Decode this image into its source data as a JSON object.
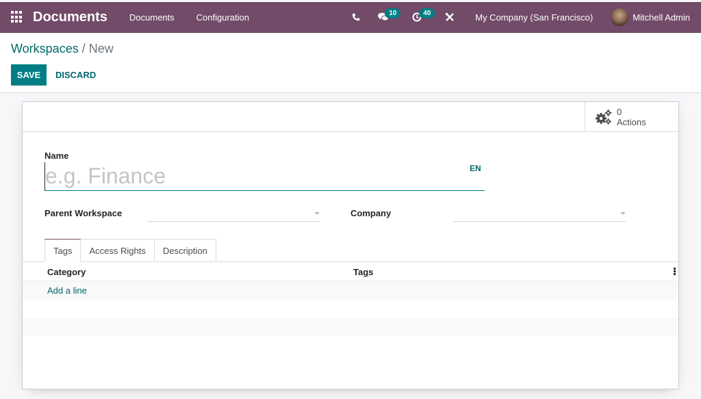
{
  "navbar": {
    "app_title": "Documents",
    "menus": [
      "Documents",
      "Configuration"
    ],
    "icons": {
      "phone": "phone-icon",
      "messages": "chat-icon",
      "activities": "clock-icon",
      "debug": "tools-icon"
    },
    "messages_count": "10",
    "activities_count": "40",
    "company": "My Company (San Francisco)",
    "user": "Mitchell Admin"
  },
  "breadcrumb": {
    "parent": "Workspaces",
    "separator": "/",
    "current": "New"
  },
  "toolbar": {
    "save_label": "SAVE",
    "discard_label": "DISCARD"
  },
  "stat_button": {
    "count": "0",
    "label": "Actions"
  },
  "form": {
    "name_label": "Name",
    "name_placeholder": "e.g. Finance",
    "name_value": "",
    "lang": "EN",
    "parent_workspace_label": "Parent Workspace",
    "parent_workspace_value": "",
    "company_label": "Company",
    "company_value": ""
  },
  "tabs": [
    {
      "label": "Tags",
      "active": true
    },
    {
      "label": "Access Rights",
      "active": false
    },
    {
      "label": "Description",
      "active": false
    }
  ],
  "list": {
    "columns": [
      "Category",
      "Tags"
    ],
    "add_line": "Add a line",
    "rows": []
  },
  "colors": {
    "brand": "#714b67",
    "primary": "#017e84",
    "link": "#01676b"
  }
}
